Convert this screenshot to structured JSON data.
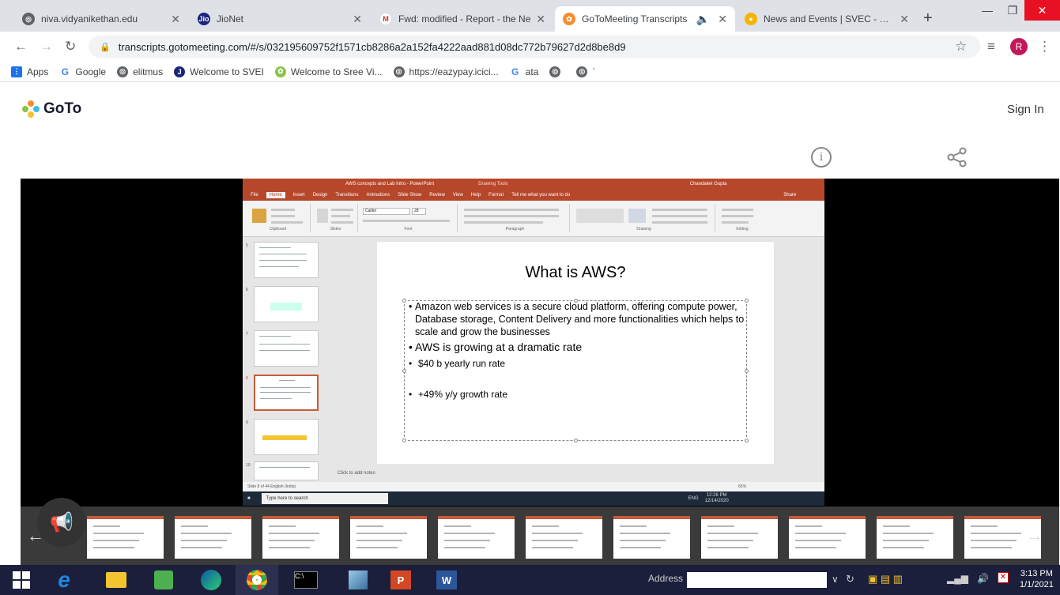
{
  "browser": {
    "tabs": [
      {
        "title": "niva.vidyanikethan.edu",
        "fav_color": "#5f6368"
      },
      {
        "title": "JioNet",
        "fav_color": "#1a237e",
        "fav_text": "Jio"
      },
      {
        "title": "Fwd: modified - Report - the Ne",
        "fav_color": "#ffffff",
        "fav_text": "M"
      },
      {
        "title": "GoToMeeting Transcripts",
        "fav_color": "#f68d2e",
        "active": true
      },
      {
        "title": "News and Events | SVEC - Sree V",
        "fav_color": "#f4b400"
      }
    ],
    "new_tab": "+",
    "url": "transcripts.gotomeeting.com/#/s/032195609752f1571cb8286a2a152fa4222aad881d08dc772b79627d2d8be8d9",
    "profile_initial": "R",
    "bookmarks": [
      {
        "label": "Apps"
      },
      {
        "label": "Google"
      },
      {
        "label": "elitmus"
      },
      {
        "label": "Welcome to SVEI"
      },
      {
        "label": "Welcome to Sree Vi..."
      },
      {
        "label": "https://eazypay.icici..."
      },
      {
        "label": "ata"
      },
      {
        "label": ""
      },
      {
        "label": "`"
      }
    ]
  },
  "page": {
    "logo_text": "GoTo",
    "sign_in": "Sign In",
    "info_glyph": "i"
  },
  "ppt": {
    "window_title": "AWS concepts and Lab Intro - PowerPoint",
    "drawing_tools": "Drawing Tools",
    "user": "Chandalek Gupta",
    "menu": [
      "File",
      "Home",
      "Insert",
      "Design",
      "Transitions",
      "Animations",
      "Slide Show",
      "Review",
      "View",
      "Help",
      "Format",
      "Tell me what you want to do"
    ],
    "share": "Share",
    "ribbon_groups": [
      "Clipboard",
      "Slides",
      "Font",
      "Paragraph",
      "Drawing",
      "Editing"
    ],
    "font_name": "Calibri",
    "font_size": "28",
    "thumbs": [
      "5",
      "6",
      "7",
      "8",
      "9",
      "10"
    ],
    "slide": {
      "title": "What is AWS?",
      "bullets": [
        "Amazon web services is a secure cloud platform, offering compute power, Database storage, Content Delivery and more functionalities which helps to scale and grow the businesses",
        "AWS is growing at a dramatic rate",
        "$40 b yearly run rate",
        "+49% y/y growth rate"
      ]
    },
    "notes_placeholder": "Click to add notes",
    "status": "Slide 8 of 44    English (India)",
    "zoom": "65%",
    "search_placeholder": "Type here to search",
    "task_lang": "ENG",
    "task_time": "12:26 PM",
    "task_date": "12/14/2020"
  },
  "filmstrip": {
    "count": 11
  },
  "taskbar": {
    "address_label": "Address",
    "time": "3:13 PM",
    "date": "1/1/2021"
  }
}
